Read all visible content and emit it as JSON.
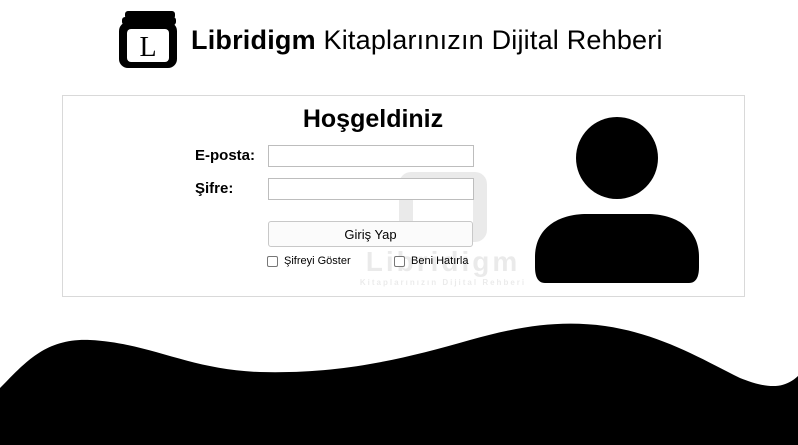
{
  "header": {
    "brand_name": "Libridigm",
    "tagline": "Kitaplarınızın Dijital Rehberi",
    "logo_letter": "L"
  },
  "login": {
    "title": "Hoşgeldiniz",
    "email_label": "E-posta:",
    "email_value": "",
    "password_label": "Şifre:",
    "password_value": "",
    "submit_label": "Giriş Yap",
    "show_password_label": "Şifreyi Göster",
    "show_password_checked": false,
    "remember_label": "Beni Hatırla",
    "remember_checked": false
  },
  "watermark": {
    "name": "Libridigm",
    "tagline": "Kitaplarınızın Dijital Rehberi"
  },
  "icons": {
    "logo": "book-stack-logo-icon",
    "avatar": "user-avatar-icon"
  },
  "colors": {
    "background": "#ffffff",
    "text": "#000000",
    "panel_border": "#d9d9d9",
    "wave": "#000000"
  }
}
